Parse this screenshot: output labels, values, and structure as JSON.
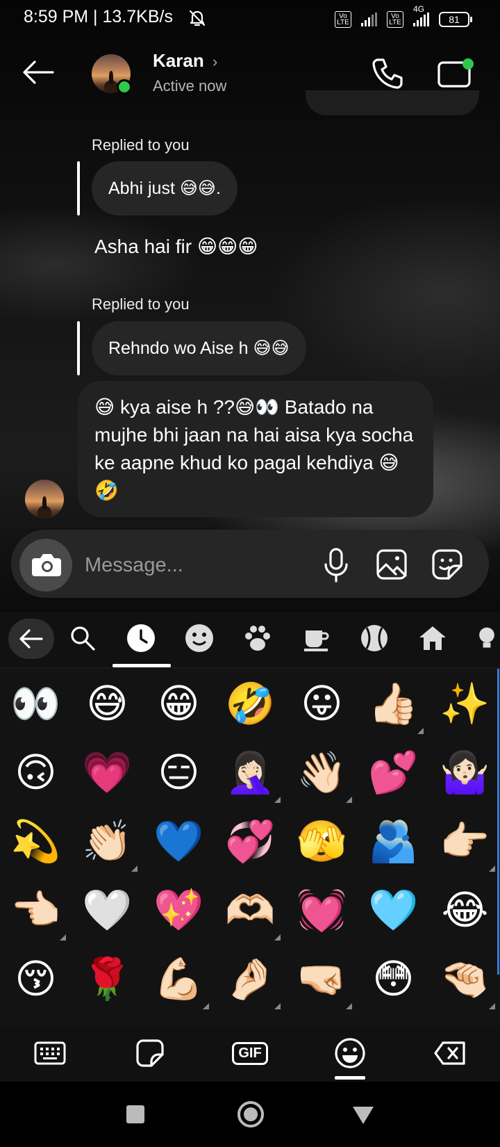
{
  "status_bar": {
    "time": "8:59 PM | 13.7KB/s",
    "volte1": "Vo LTE",
    "volte2": "Vo LTE",
    "network": "4G",
    "battery": "81"
  },
  "header": {
    "contact_name": "Karan",
    "contact_status": "Active now",
    "icons": [
      "back-arrow-icon",
      "call-icon",
      "video-call-icon"
    ]
  },
  "messages": [
    {
      "reply_label": "Replied to you",
      "quoted": "Abhi just 😅😅."
    },
    {
      "text": "Asha hai fir 😁😁😁"
    },
    {
      "reply_label": "Replied to you",
      "quoted": "Rehndo wo Aise h 😅😅"
    },
    {
      "text": "😅 kya aise h ??😅👀 Batado na mujhe bhi jaan na hai aisa kya socha ke aapne khud ko pagal kehdiya 😅🤣"
    }
  ],
  "composer": {
    "placeholder": "Message...",
    "icons": [
      "camera-icon",
      "microphone-icon",
      "gallery-icon",
      "sticker-icon"
    ]
  },
  "emoji_keyboard": {
    "categories": [
      "back-icon",
      "search-icon",
      "recent-icon",
      "smileys-icon",
      "animals-icon",
      "food-icon",
      "activities-icon",
      "travel-icon",
      "objects-icon"
    ],
    "selected_category": "recent-icon",
    "emojis": [
      [
        "👀",
        "😅",
        "😁",
        "🤣",
        "😛",
        "👍🏻",
        "✨"
      ],
      [
        "🙃",
        "💗",
        "😑",
        "🤦🏻‍♀️",
        "👋🏻",
        "💕",
        "🤷🏻‍♀️"
      ],
      [
        "💫",
        "👏🏻",
        "💙",
        "💞",
        "🫣",
        "🫂",
        "👉🏻"
      ],
      [
        "👈🏻",
        "🤍",
        "💖",
        "🫶🏻",
        "💓",
        "🩵",
        "😂"
      ],
      [
        "😚",
        "🌹",
        "💪🏻",
        "🤌🏻",
        "🤜🏻",
        "😳",
        "🤏🏻"
      ]
    ],
    "variant_markers": [
      [
        false,
        false,
        false,
        false,
        false,
        true,
        false
      ],
      [
        false,
        false,
        false,
        true,
        true,
        false,
        false
      ],
      [
        false,
        true,
        false,
        false,
        false,
        false,
        true
      ],
      [
        true,
        false,
        false,
        true,
        false,
        false,
        false
      ],
      [
        false,
        false,
        true,
        true,
        true,
        false,
        true
      ]
    ],
    "bottom_tools": [
      "keyboard-icon",
      "sticker-icon",
      "GIF",
      "emoji-icon",
      "backspace-icon"
    ],
    "selected_tool": "emoji-icon"
  },
  "nav": [
    "recents-icon",
    "home-icon",
    "back-icon"
  ]
}
